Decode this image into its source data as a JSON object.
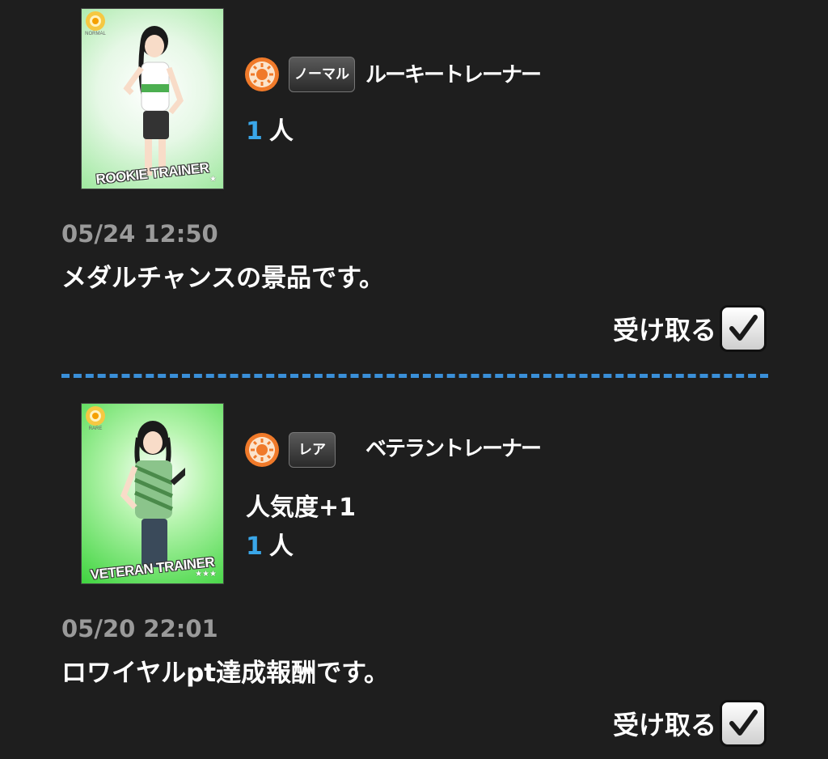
{
  "gifts": [
    {
      "card_name": "ROOKIE TRAINER",
      "card_rarity_small": "NORMAL",
      "card_stars": "★",
      "rarity_label": "ノーマル",
      "idol_name": "ルーキートレーナー",
      "effect": "",
      "quantity_number": "1",
      "quantity_unit": "人",
      "date": "05/24 12:50",
      "message": "メダルチャンスの景品です。",
      "receive_label": "受け取る"
    },
    {
      "card_name": "VETERAN TRAINER",
      "card_rarity_small": "RARE",
      "card_stars": "★★★",
      "rarity_label": "レア",
      "idol_name": "ベテラントレーナー",
      "effect": "人気度+1",
      "quantity_number": "1",
      "quantity_unit": "人",
      "date": "05/20 22:01",
      "message": "ロワイヤルpt達成報酬です。",
      "receive_label": "受け取る"
    }
  ],
  "colors": {
    "background": "#1e1e1e",
    "quantity_accent": "#3aa6e8",
    "divider": "#3a8fd8",
    "date_text": "#9a9a9a",
    "card_green": "#3fd43f",
    "sun_orange": "#f07a2a"
  },
  "icons": {
    "attribute": "sun-attribute-icon",
    "receive": "checkmark-icon"
  }
}
